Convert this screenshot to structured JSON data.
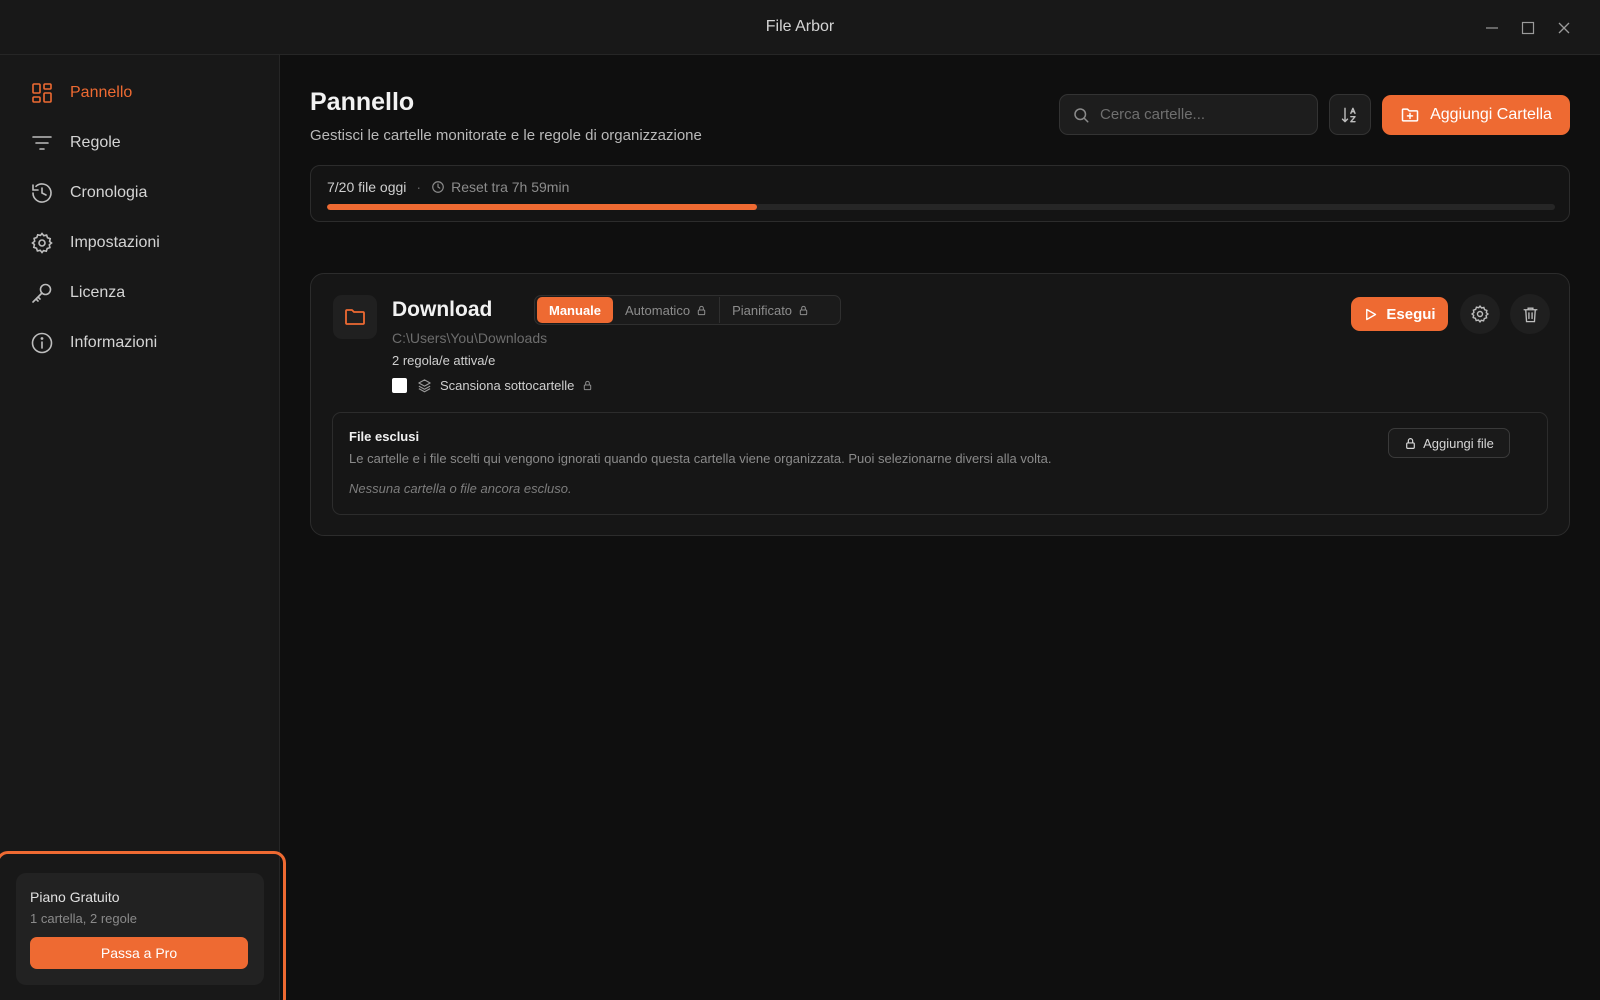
{
  "window": {
    "title": "File Arbor"
  },
  "sidebar": {
    "items": [
      {
        "label": "Pannello",
        "icon": "dashboard-icon",
        "active": true
      },
      {
        "label": "Regole",
        "icon": "filter-icon",
        "active": false
      },
      {
        "label": "Cronologia",
        "icon": "history-icon",
        "active": false
      },
      {
        "label": "Impostazioni",
        "icon": "gear-icon",
        "active": false
      },
      {
        "label": "Licenza",
        "icon": "key-icon",
        "active": false
      },
      {
        "label": "Informazioni",
        "icon": "info-icon",
        "active": false
      }
    ],
    "plan": {
      "title": "Piano Gratuito",
      "subtitle": "1 cartella, 2 regole",
      "upgrade_label": "Passa a Pro"
    }
  },
  "header": {
    "title": "Pannello",
    "subtitle": "Gestisci le cartelle monitorate e le regole di organizzazione",
    "search_placeholder": "Cerca cartelle...",
    "add_folder_label": "Aggiungi Cartella"
  },
  "quota": {
    "files_today": "7/20 file oggi",
    "separator": "·",
    "reset_text": "Reset tra 7h 59min",
    "progress_fraction": 0.35
  },
  "folder": {
    "name": "Download",
    "modes": [
      {
        "label": "Manuale",
        "active": true,
        "locked": false
      },
      {
        "label": "Automatico",
        "active": false,
        "locked": true
      },
      {
        "label": "Pianificato",
        "active": false,
        "locked": true
      }
    ],
    "path": "C:\\Users\\You\\Downloads",
    "rules_active": "2 regola/e attiva/e",
    "scan_subfolders_label": "Scansiona sottocartelle",
    "run_label": "Esegui",
    "excluded": {
      "title": "File esclusi",
      "description": "Le cartelle e i file scelti qui vengono ignorati quando questa cartella viene organizzata. Puoi selezionarne diversi alla volta.",
      "empty_text": "Nessuna cartella o file ancora escluso.",
      "add_label": "Aggiungi file"
    }
  },
  "colors": {
    "accent": "#ee6a32",
    "background": "#0f0f0f",
    "sidebar": "#181818"
  }
}
